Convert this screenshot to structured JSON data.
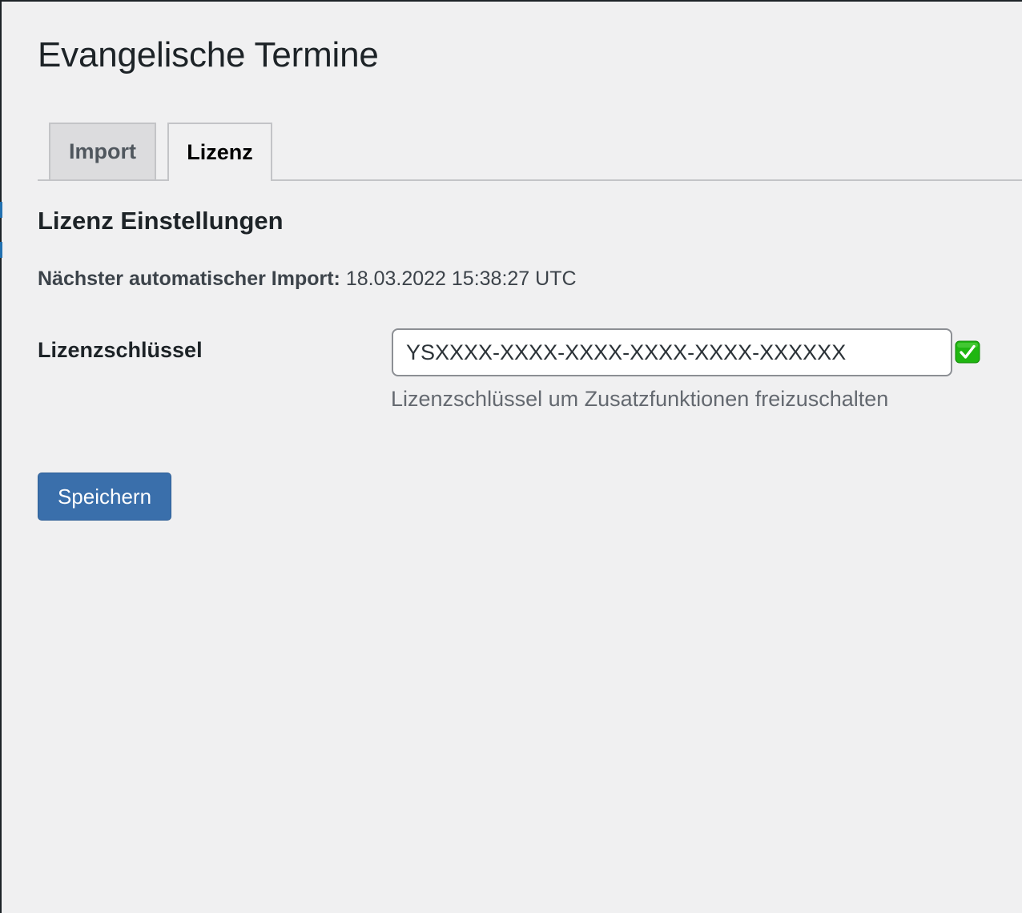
{
  "page": {
    "title": "Evangelische Termine"
  },
  "tabs": [
    {
      "label": "Import",
      "active": false
    },
    {
      "label": "Lizenz",
      "active": true
    }
  ],
  "section": {
    "title": "Lizenz Einstellungen"
  },
  "next_import": {
    "label": "Nächster automatischer Import:",
    "value": "18.03.2022 15:38:27 UTC"
  },
  "license": {
    "label": "Lizenzschlüssel",
    "value": "YSXXXX-XXXX-XXXX-XXXX-XXXX-XXXXXX",
    "description": "Lizenzschlüssel um Zusatzfunktionen freizuschalten",
    "status_icon": "check-mark-icon",
    "status_color": "#1fb611"
  },
  "actions": {
    "save_label": "Speichern"
  },
  "colors": {
    "background": "#f0f0f1",
    "primary_button": "#3a6fab",
    "admin_accent": "#2271b1"
  }
}
